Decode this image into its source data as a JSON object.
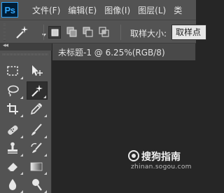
{
  "app": {
    "logo": "Ps"
  },
  "menu": {
    "items": [
      {
        "label": "文件(F)"
      },
      {
        "label": "编辑(E)"
      },
      {
        "label": "图像(I)"
      },
      {
        "label": "图层(L)"
      },
      {
        "label": "类"
      }
    ]
  },
  "options": {
    "tool_icon": "magic-wand-icon",
    "selection_modes": [
      "new-selection-icon",
      "add-to-selection-icon",
      "subtract-from-selection-icon",
      "intersect-selection-icon"
    ],
    "sample_size_label": "取样大小:",
    "sample_size_value": "取样点"
  },
  "toolbar": {
    "collapse_label": "◂◂",
    "active_tool": "magic-wand-icon",
    "tools": [
      "rectangular-marquee-icon",
      "move-icon",
      "lasso-icon",
      "magic-wand-icon",
      "crop-icon",
      "eyedropper-icon",
      "spot-healing-brush-icon",
      "brush-icon",
      "clone-stamp-icon",
      "history-brush-icon",
      "eraser-icon",
      "gradient-icon",
      "blur-icon",
      "dodge-icon"
    ]
  },
  "document": {
    "tab_label": "未标题-1 @ 6.25%(RGB/8)",
    "close_label": "×"
  },
  "watermark": {
    "name": "搜狗指南",
    "url": "zhinan.sogou.com"
  }
}
